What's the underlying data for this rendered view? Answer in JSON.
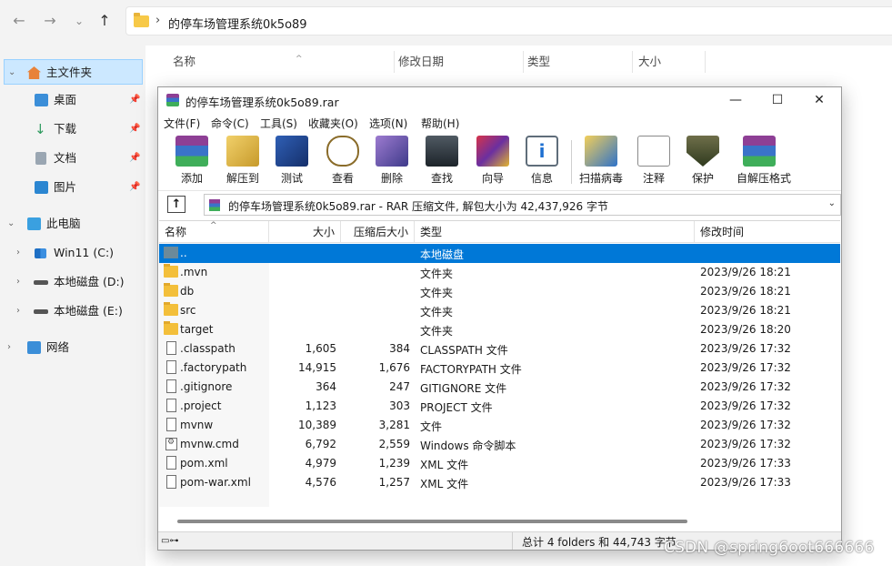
{
  "explorer": {
    "address_path": "的停车场管理系统0k5o89",
    "nav": {
      "back": "←",
      "forward": "→",
      "recent": "⌄",
      "up": "↑",
      "sep": "›"
    },
    "sidebar": [
      {
        "label": "主文件夹",
        "icon": "home-icon"
      },
      {
        "label": "桌面",
        "icon": "desktop-icon"
      },
      {
        "label": "下载",
        "icon": "download-icon"
      },
      {
        "label": "文档",
        "icon": "document-icon"
      },
      {
        "label": "图片",
        "icon": "pictures-icon"
      },
      {
        "label": "此电脑",
        "icon": "computer-icon"
      },
      {
        "label": "Win11 (C:)",
        "icon": "drive-windows-icon"
      },
      {
        "label": "本地磁盘 (D:)",
        "icon": "drive-icon"
      },
      {
        "label": "本地磁盘 (E:)",
        "icon": "drive-icon"
      },
      {
        "label": "网络",
        "icon": "network-icon"
      }
    ],
    "columns": [
      "名称",
      "修改日期",
      "类型",
      "大小"
    ]
  },
  "rar": {
    "title": "的停车场管理系统0k5o89.rar",
    "window_controls": {
      "minimize": "—",
      "maximize": "☐",
      "close": "✕"
    },
    "menu": [
      "文件(F)",
      "命令(C)",
      "工具(S)",
      "收藏夹(O)",
      "选项(N)",
      "帮助(H)"
    ],
    "toolbar": [
      {
        "label": "添加",
        "icon": "add-icon"
      },
      {
        "label": "解压到",
        "icon": "extract-icon"
      },
      {
        "label": "测试",
        "icon": "test-icon"
      },
      {
        "label": "查看",
        "icon": "view-icon"
      },
      {
        "label": "删除",
        "icon": "delete-icon"
      },
      {
        "label": "查找",
        "icon": "find-icon"
      },
      {
        "label": "向导",
        "icon": "wizard-icon"
      },
      {
        "label": "信息",
        "icon": "info-icon"
      },
      {
        "label": "扫描病毒",
        "icon": "virus-scan-icon"
      },
      {
        "label": "注释",
        "icon": "comment-icon"
      },
      {
        "label": "保护",
        "icon": "protect-icon"
      },
      {
        "label": "自解压格式",
        "icon": "sfx-icon"
      }
    ],
    "path_text": "的停车场管理系统0k5o89.rar - RAR 压缩文件, 解包大小为 42,437,926 字节",
    "columns": {
      "name": "名称",
      "size": "大小",
      "packed": "压缩后大小",
      "type": "类型",
      "modified": "修改时间"
    },
    "rows": [
      {
        "name": "..",
        "size": "",
        "packed": "",
        "type": "本地磁盘",
        "modified": "",
        "kind": "up"
      },
      {
        "name": ".mvn",
        "size": "",
        "packed": "",
        "type": "文件夹",
        "modified": "2023/9/26 18:21",
        "kind": "folder"
      },
      {
        "name": "db",
        "size": "",
        "packed": "",
        "type": "文件夹",
        "modified": "2023/9/26 18:21",
        "kind": "folder"
      },
      {
        "name": "src",
        "size": "",
        "packed": "",
        "type": "文件夹",
        "modified": "2023/9/26 18:21",
        "kind": "folder"
      },
      {
        "name": "target",
        "size": "",
        "packed": "",
        "type": "文件夹",
        "modified": "2023/9/26 18:20",
        "kind": "folder"
      },
      {
        "name": ".classpath",
        "size": "1,605",
        "packed": "384",
        "type": "CLASSPATH 文件",
        "modified": "2023/9/26 17:32",
        "kind": "file"
      },
      {
        "name": ".factorypath",
        "size": "14,915",
        "packed": "1,676",
        "type": "FACTORYPATH 文件",
        "modified": "2023/9/26 17:32",
        "kind": "file"
      },
      {
        "name": ".gitignore",
        "size": "364",
        "packed": "247",
        "type": "GITIGNORE 文件",
        "modified": "2023/9/26 17:32",
        "kind": "file"
      },
      {
        "name": ".project",
        "size": "1,123",
        "packed": "303",
        "type": "PROJECT 文件",
        "modified": "2023/9/26 17:32",
        "kind": "file"
      },
      {
        "name": "mvnw",
        "size": "10,389",
        "packed": "3,281",
        "type": "文件",
        "modified": "2023/9/26 17:32",
        "kind": "file"
      },
      {
        "name": "mvnw.cmd",
        "size": "6,792",
        "packed": "2,559",
        "type": "Windows 命令脚本",
        "modified": "2023/9/26 17:32",
        "kind": "cmd"
      },
      {
        "name": "pom.xml",
        "size": "4,979",
        "packed": "1,239",
        "type": "XML 文件",
        "modified": "2023/9/26 17:33",
        "kind": "file"
      },
      {
        "name": "pom-war.xml",
        "size": "4,576",
        "packed": "1,257",
        "type": "XML 文件",
        "modified": "2023/9/26 17:33",
        "kind": "file"
      }
    ],
    "status_text": "总计 4 folders 和 44,743 字节"
  },
  "watermark": "CSDN @spring6oot666666"
}
